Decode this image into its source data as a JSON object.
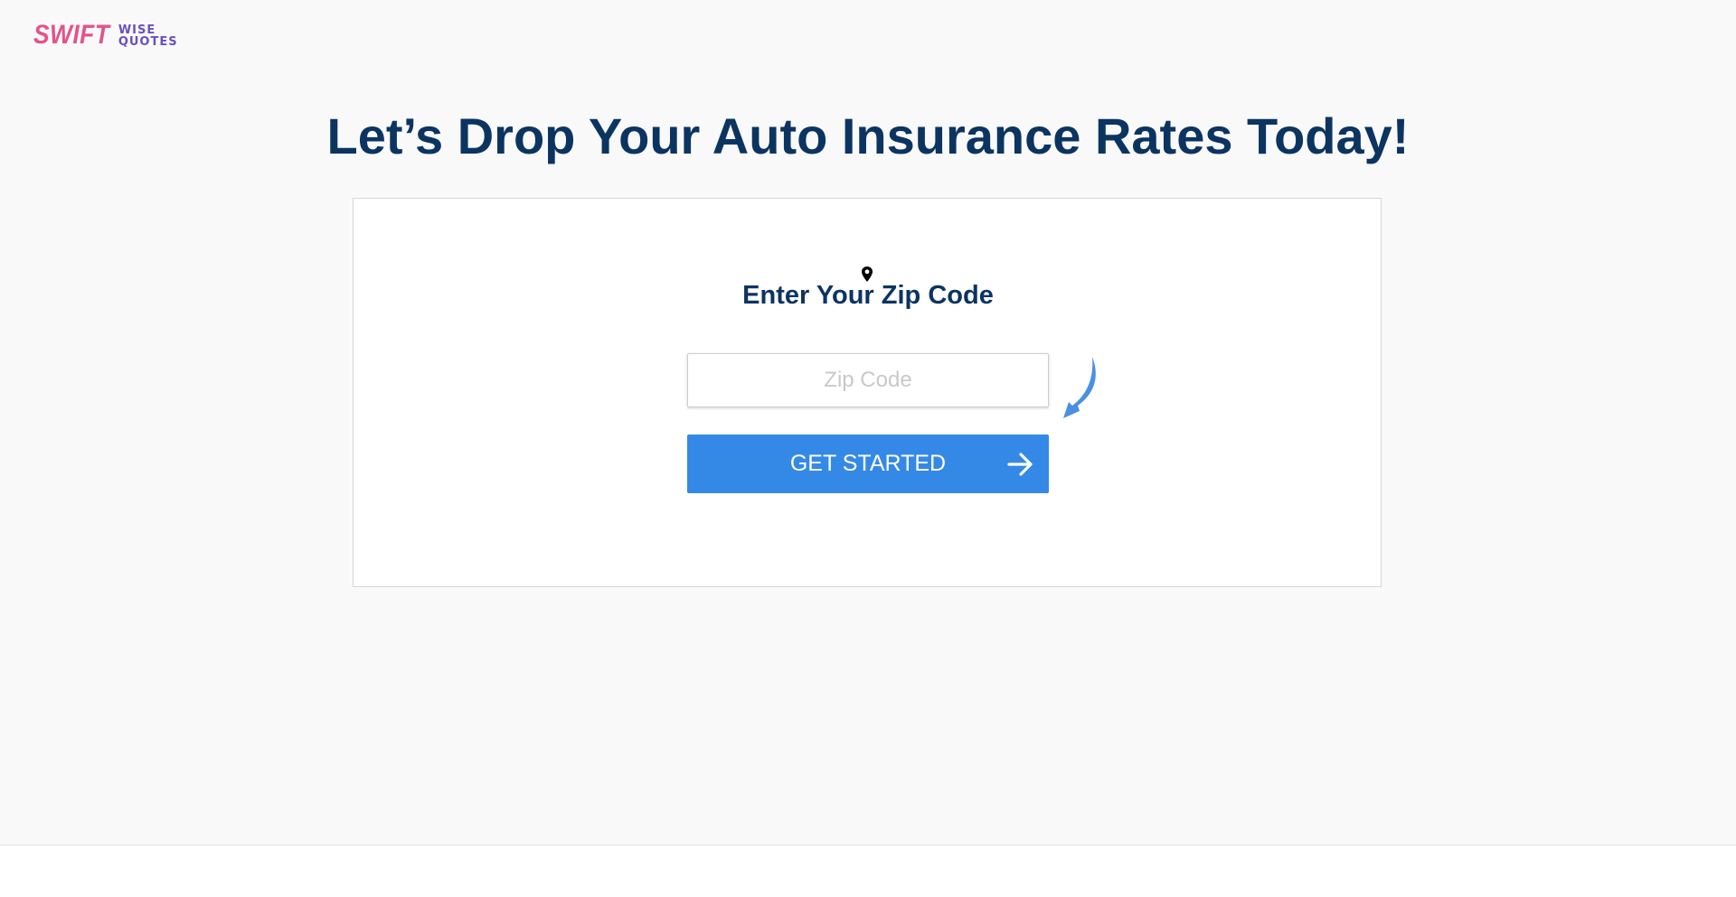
{
  "header": {
    "logo": {
      "word1": "SWIFT",
      "word2": "WISE",
      "word3": "QUOTES"
    }
  },
  "main": {
    "headline": "Let’s Drop Your Auto Insurance Rates Today!",
    "card": {
      "icon": "map-pin-icon",
      "heading": "Enter Your Zip Code",
      "zip_input": {
        "placeholder": "Zip Code",
        "value": ""
      },
      "hint_icon": "curved-arrow-icon",
      "cta": {
        "label": "GET STARTED",
        "icon": "arrow-right-icon"
      }
    }
  },
  "colors": {
    "background": "#f9f9f9",
    "headline": "#0c3461",
    "button": "#3589e6",
    "logo_swift": "#e2548a",
    "logo_wise_quotes": "#6a4fc0",
    "hint_arrow": "#4a90e2"
  }
}
